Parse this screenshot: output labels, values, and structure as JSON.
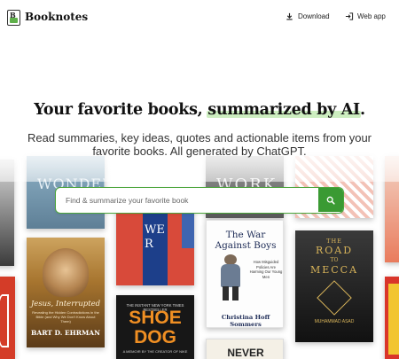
{
  "header": {
    "brand": "Booknotes",
    "download_label": "Download",
    "webapp_label": "Web app"
  },
  "hero": {
    "title_part1": "Your favorite books, ",
    "title_highlight": "summarized by AI",
    "title_end": ".",
    "subtitle": "Read summaries, key ideas, quotes and actionable items from your favorite books. All generated by ChatGPT."
  },
  "search": {
    "placeholder": "Find & summarize your favorite book"
  },
  "books": {
    "jesus": {
      "title": "Jesus, Interrupted",
      "subtitle": "Revealing the Hidden Contradictions in the Bible (and Why We Don't Know About Them)",
      "author": "BART D. EHRMAN"
    },
    "shoe_dog": {
      "banner": "THE INSTANT NEW YORK TIMES BESTSELLER",
      "title": "SHOE DOG",
      "tagline": "A MEMOIR BY THE CREATOR OF NIKE"
    },
    "war_boys": {
      "title": "The War Against Boys",
      "subtitle": "How Misguided Policies Are Harming Our Young Men",
      "author": "Christina Hoff Sommers"
    },
    "mecca": {
      "title_the": "THE",
      "title_road": "ROAD",
      "title_to": "TO",
      "title_mecca": "MECCA",
      "author": "MUHAMMAD ASAD"
    },
    "wer": {
      "title": "WER"
    },
    "work": {
      "title": "WORK"
    },
    "wonder": {
      "title": "WONDER"
    },
    "never": {
      "title": "NEVER"
    }
  },
  "colors": {
    "accent": "#3a9a33",
    "highlight": "#cdeec0"
  },
  "icons": {
    "download": "download-icon",
    "webapp": "login-arrow-icon",
    "search": "search-icon"
  }
}
